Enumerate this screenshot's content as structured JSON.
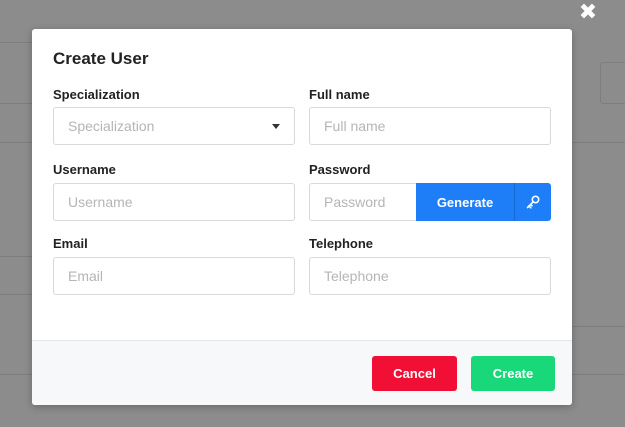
{
  "modal": {
    "title": "Create User",
    "close_glyph": "✖",
    "fields": {
      "specialization": {
        "label": "Specialization",
        "placeholder": "Specialization",
        "value": ""
      },
      "full_name": {
        "label": "Full name",
        "placeholder": "Full name",
        "value": ""
      },
      "username": {
        "label": "Username",
        "placeholder": "Username",
        "value": ""
      },
      "password": {
        "label": "Password",
        "placeholder": "Password",
        "value": "",
        "generate_label": "Generate"
      },
      "email": {
        "label": "Email",
        "placeholder": "Email",
        "value": ""
      },
      "telephone": {
        "label": "Telephone",
        "placeholder": "Telephone",
        "value": ""
      }
    },
    "footer": {
      "cancel_label": "Cancel",
      "create_label": "Create"
    }
  },
  "icons": {
    "close": "close-icon",
    "dropdown": "caret-down-icon",
    "key": "key-icon"
  },
  "colors": {
    "primary": "#1e7ef7",
    "danger": "#f20f36",
    "success": "#18d879",
    "backdrop": "#8c8c8c"
  }
}
